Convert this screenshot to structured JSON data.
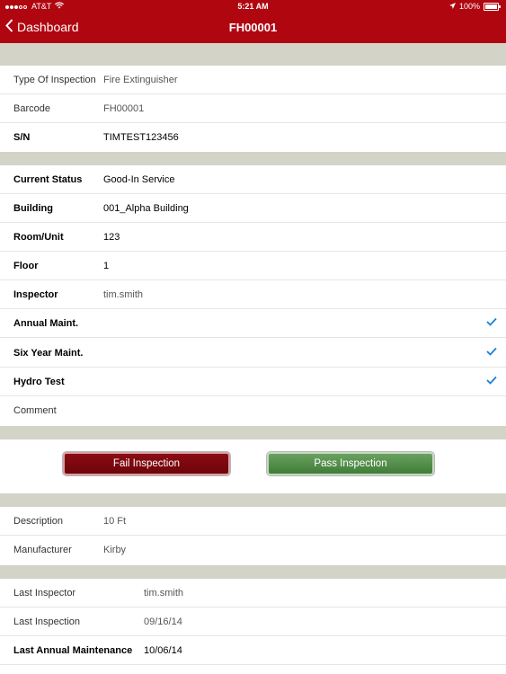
{
  "status_bar": {
    "carrier": "AT&T",
    "time": "5:21 AM",
    "battery": "100%",
    "battery_level": 1.0
  },
  "nav": {
    "back_label": "Dashboard",
    "title": "FH00001"
  },
  "sections": {
    "identity": [
      {
        "label": "Type Of Inspection",
        "value": "Fire Extinguisher"
      },
      {
        "label": "Barcode",
        "value": "FH00001"
      },
      {
        "label": "S/N",
        "value": "TIMTEST123456"
      }
    ],
    "status": [
      {
        "label": "Current Status",
        "value": "Good-In Service"
      },
      {
        "label": "Building",
        "value": "001_Alpha Building"
      },
      {
        "label": "Room/Unit",
        "value": "123"
      },
      {
        "label": "Floor",
        "value": "1"
      },
      {
        "label": "Inspector",
        "value": "tim.smith"
      },
      {
        "label": "Annual Maint.",
        "checked": true
      },
      {
        "label": "Six Year Maint.",
        "checked": true
      },
      {
        "label": "Hydro Test",
        "checked": true
      },
      {
        "label": "Comment",
        "value": ""
      }
    ],
    "details": [
      {
        "label": "Description",
        "value": "10 Ft"
      },
      {
        "label": "Manufacturer",
        "value": "Kirby"
      }
    ],
    "history": [
      {
        "label": "Last Inspector",
        "value": "tim.smith"
      },
      {
        "label": "Last Inspection",
        "value": "09/16/14"
      },
      {
        "label": "Last Annual Maintenance",
        "value": "10/06/14"
      }
    ]
  },
  "actions": {
    "fail_label": "Fail Inspection",
    "pass_label": "Pass Inspection"
  },
  "colors": {
    "brand_red": "#b00610",
    "section_gray": "#d3d3c8",
    "check_blue": "#1a7fd4",
    "fail_red": "#7d0a10",
    "pass_green": "#4f8c47"
  }
}
